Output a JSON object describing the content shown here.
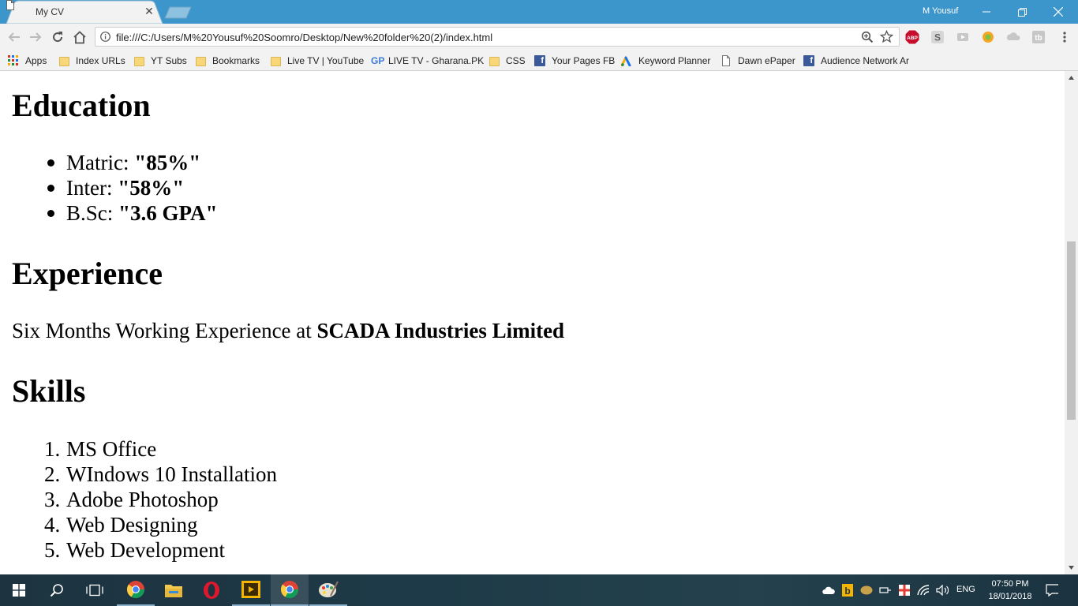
{
  "browser": {
    "tab_title": "My CV",
    "profile_name": "M Yousuf",
    "url": "file:///C:/Users/M%20Yousuf%20Soomro/Desktop/New%20folder%20(2)/index.html"
  },
  "bookmarks": [
    {
      "label": "Apps",
      "icon": "apps-grid-icon"
    },
    {
      "label": "Index URLs",
      "icon": "folder-icon"
    },
    {
      "label": "YT Subs",
      "icon": "folder-icon"
    },
    {
      "label": "Bookmarks",
      "icon": "folder-icon"
    },
    {
      "label": "Live TV | YouTube",
      "icon": "folder-icon"
    },
    {
      "label": "LIVE TV - Gharana.PK",
      "icon": "gp-icon"
    },
    {
      "label": "CSS",
      "icon": "folder-icon"
    },
    {
      "label": "Your Pages FB",
      "icon": "facebook-icon"
    },
    {
      "label": "Keyword Planner",
      "icon": "adwords-icon"
    },
    {
      "label": "Dawn ePaper",
      "icon": "page-icon"
    },
    {
      "label": "Audience Network Ar",
      "icon": "facebook-icon"
    }
  ],
  "page": {
    "education": {
      "heading": "Education",
      "items": [
        {
          "label": "Matric: ",
          "value": "\"85%\""
        },
        {
          "label": "Inter: ",
          "value": "\"58%\""
        },
        {
          "label": "B.Sc: ",
          "value": "\"3.6 GPA\""
        }
      ]
    },
    "experience": {
      "heading": "Experience",
      "text": "Six Months Working Experience at ",
      "company": "SCADA Industries Limited"
    },
    "skills": {
      "heading": "Skills",
      "items": [
        {
          "num": "1.",
          "label": "MS Office"
        },
        {
          "num": "2.",
          "label": "WIndows 10 Installation"
        },
        {
          "num": "3.",
          "label": "Adobe Photoshop"
        },
        {
          "num": "4.",
          "label": "Web Designing"
        },
        {
          "num": "5.",
          "label": "Web Development"
        }
      ]
    }
  },
  "taskbar": {
    "language": "ENG",
    "time": "07:50 PM",
    "date": "18/01/2018"
  },
  "colors": {
    "titlebar": "#3c96cc",
    "toolbar": "#f2f2f2"
  }
}
